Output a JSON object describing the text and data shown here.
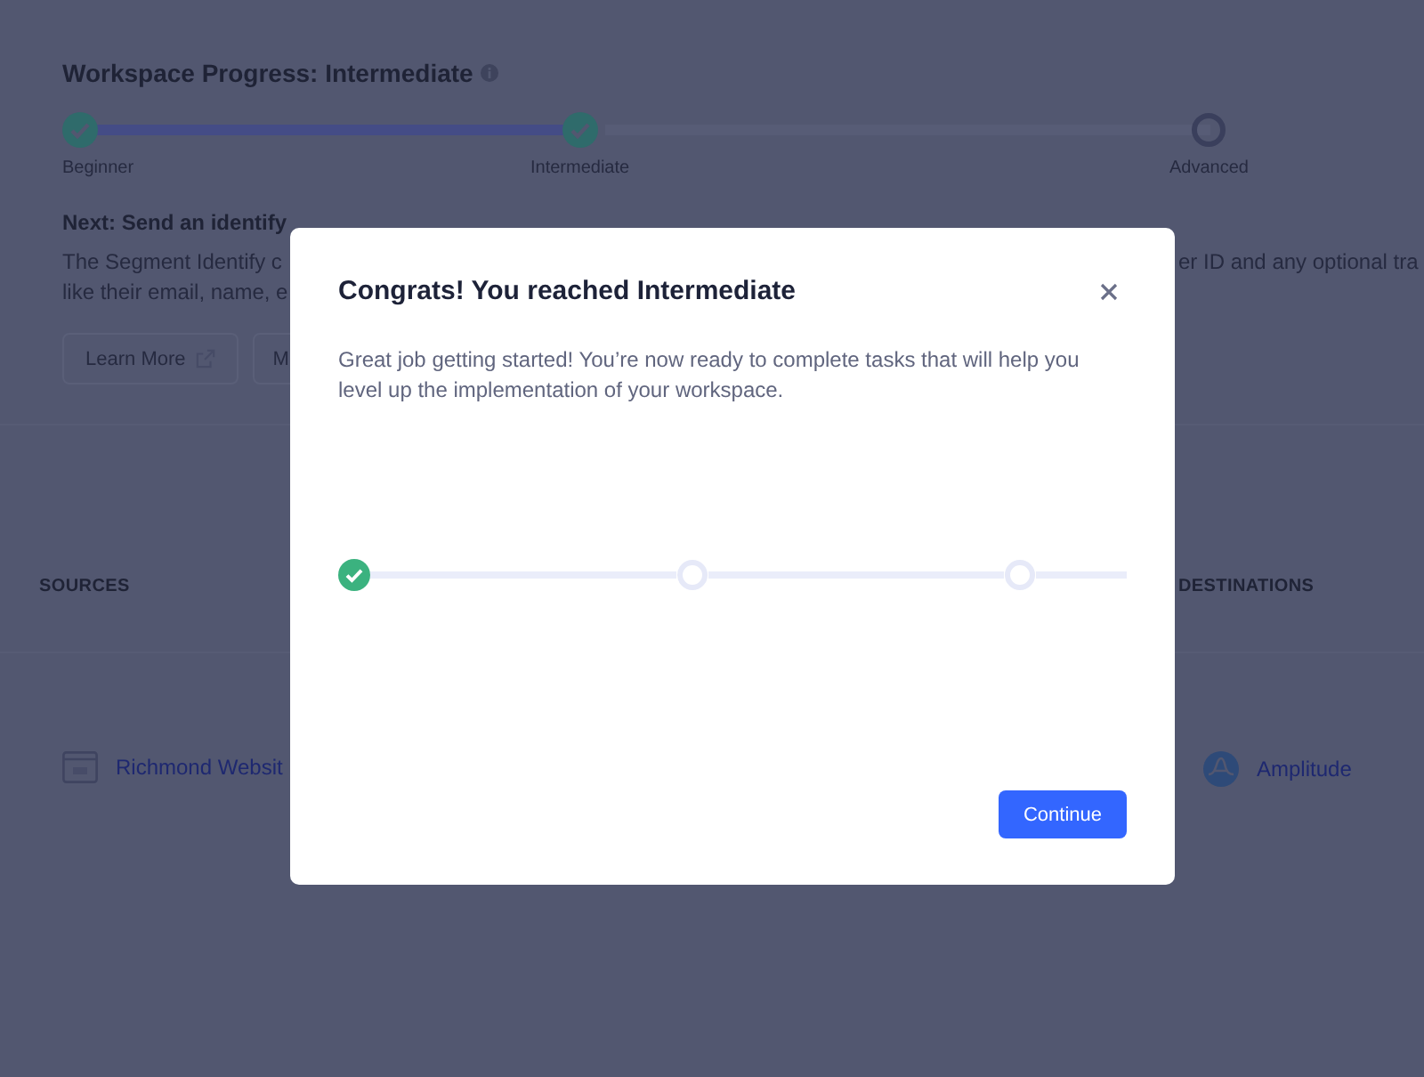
{
  "page": {
    "title": "Workspace Progress: Intermediate",
    "steps": [
      {
        "label": "Beginner",
        "done": true
      },
      {
        "label": "Intermediate",
        "done": true
      },
      {
        "label": "Advanced",
        "done": false
      }
    ],
    "next": {
      "heading": "Next: Send an identify",
      "description_left": [
        "The Segment Identify c",
        "like their email, name, e"
      ],
      "description_right": "er ID and any optional tra"
    },
    "buttons": [
      {
        "label": "Learn More",
        "kind": "external"
      },
      {
        "label": "M",
        "kind": "plain"
      }
    ],
    "sources": {
      "heading": "SOURCES",
      "items": [
        {
          "name": "Richmond Websit"
        }
      ]
    },
    "destinations": {
      "heading": "DESTINATIONS",
      "items": [
        {
          "name": "Amplitude"
        }
      ]
    }
  },
  "modal": {
    "title": "Congrats! You reached Intermediate",
    "body": "Great job getting started! You’re now ready to complete tasks that will help you level up the implementation of your workspace.",
    "steps": [
      {
        "done": true
      },
      {
        "done": false
      },
      {
        "done": false
      }
    ],
    "button": "Continue"
  }
}
